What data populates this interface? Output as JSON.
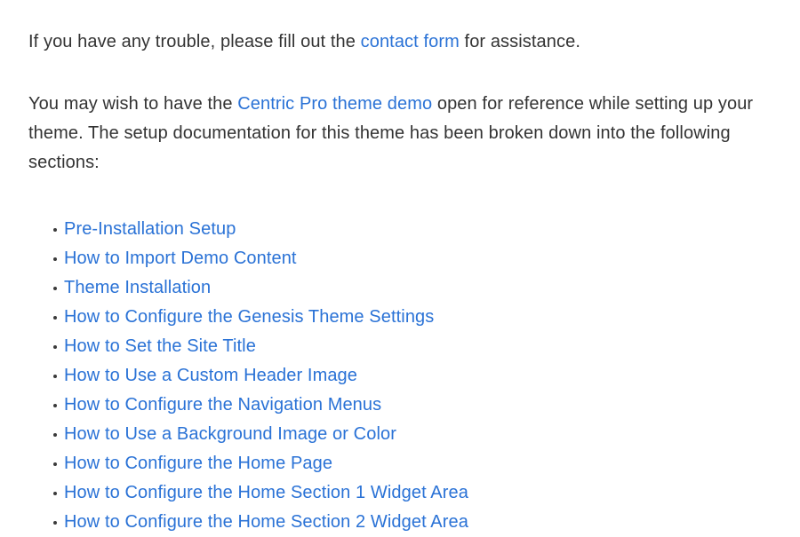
{
  "page": {
    "background_color": "#ffffff",
    "text_color": "#333333",
    "link_color": "#2a72d6"
  },
  "paragraphs": {
    "intro": {
      "before_link": "If you have any trouble, please fill out the ",
      "link_text": "contact form",
      "after_link": " for assistance."
    },
    "reference": {
      "before_link": "You may wish to have the ",
      "link_text": "Centric Pro theme demo",
      "after_link": " open for reference while setting up your theme. The setup documentation for this theme has been broken down into the following sections:"
    }
  },
  "section_list": {
    "bullet_glyph": "•",
    "items": [
      {
        "label": "Pre-Installation Setup"
      },
      {
        "label": "How to Import Demo Content"
      },
      {
        "label": "Theme Installation"
      },
      {
        "label": "How to Configure the Genesis Theme Settings"
      },
      {
        "label": "How to Set the Site Title"
      },
      {
        "label": "How to Use a Custom Header Image"
      },
      {
        "label": "How to Configure the Navigation Menus"
      },
      {
        "label": "How to Use a Background Image or Color"
      },
      {
        "label": "How to Configure the Home Page"
      },
      {
        "label": "How to Configure the Home Section 1 Widget Area"
      },
      {
        "label": "How to Configure the Home Section 2 Widget Area"
      }
    ]
  }
}
